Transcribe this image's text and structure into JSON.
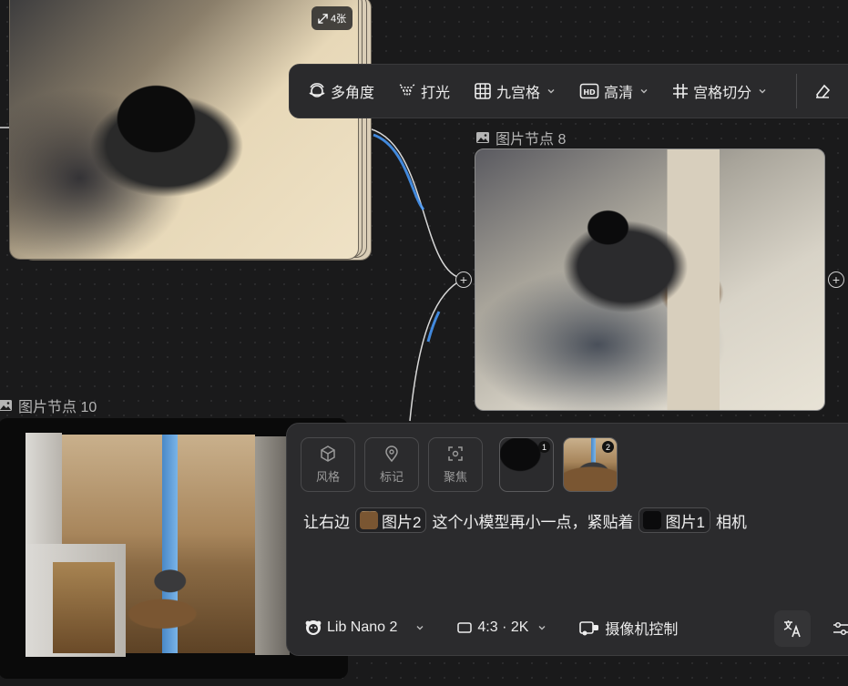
{
  "stack_node": {
    "count_badge": "4张"
  },
  "toolbar": {
    "items": [
      {
        "label": "多角度",
        "icon": "multi-angle-icon"
      },
      {
        "label": "打光",
        "icon": "lighting-icon"
      },
      {
        "label": "九宫格",
        "icon": "grid-icon"
      },
      {
        "label": "高清",
        "icon": "hd-icon"
      },
      {
        "label": "宫格切分",
        "icon": "grid-split-icon"
      }
    ]
  },
  "nodes": {
    "node8_label": "图片节点 8",
    "node10_label": "图片节点 10"
  },
  "panel": {
    "tools": [
      {
        "label": "风格",
        "icon": "cube-icon"
      },
      {
        "label": "标记",
        "icon": "pin-icon"
      },
      {
        "label": "聚焦",
        "icon": "focus-icon"
      }
    ],
    "references": [
      {
        "num": "1"
      },
      {
        "num": "2"
      }
    ],
    "prompt": {
      "part1": "让右边",
      "chip1": "图片2",
      "part2": "这个小模型再小一点，紧贴着",
      "chip2": "图片1",
      "part3": "相机"
    },
    "model": "Lib Nano 2",
    "ratio": "4:3 · 2K",
    "camera": "摄像机控制"
  },
  "colors": {
    "background": "#1a1a1b",
    "panel": "#2b2b2d",
    "connector_highlight": "#4a9eff"
  }
}
